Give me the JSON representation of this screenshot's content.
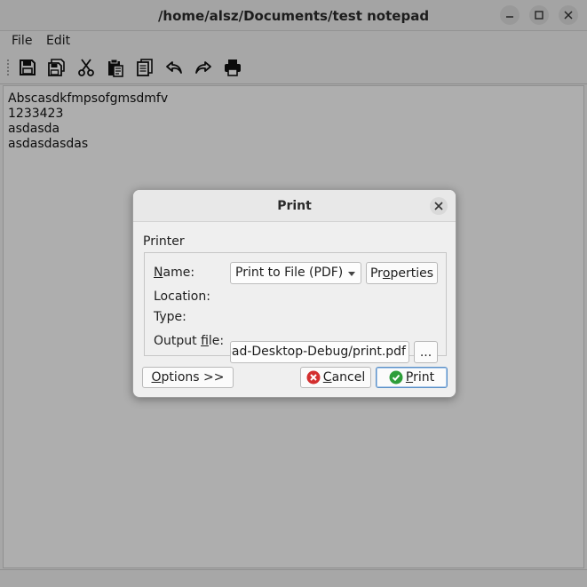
{
  "window": {
    "title": "/home/alsz/Documents/test notepad",
    "controls": [
      "minimize-icon",
      "maximize-icon",
      "close-icon"
    ]
  },
  "menubar": {
    "file": "File",
    "edit": "Edit"
  },
  "toolbar": {
    "icons": [
      "save-icon",
      "save-as-icon",
      "cut-icon",
      "paste-icon",
      "copy-icon",
      "undo-icon",
      "redo-icon",
      "print-icon"
    ]
  },
  "editor": {
    "lines": [
      "Abscasdkfmpsofgmsdmfv",
      "1233423",
      "asdasda",
      "asdasdasdas"
    ]
  },
  "dialog": {
    "title": "Print",
    "group_label": "Printer",
    "name_label": "Name:",
    "printer_selected": "Print to File (PDF)",
    "properties_label": "Properties",
    "location_label": "Location:",
    "type_label": "Type:",
    "output_label": "Output file:",
    "output_value": "/home/alsz/Documents/build-notepad-Desktop-Debug/print.pdf",
    "browse_label": "...",
    "options_label": "Options >>",
    "cancel_label": "Cancel",
    "print_label": "Print",
    "colors": {
      "cancel_icon": "#d32f2f",
      "print_icon": "#2e9e3a"
    }
  }
}
